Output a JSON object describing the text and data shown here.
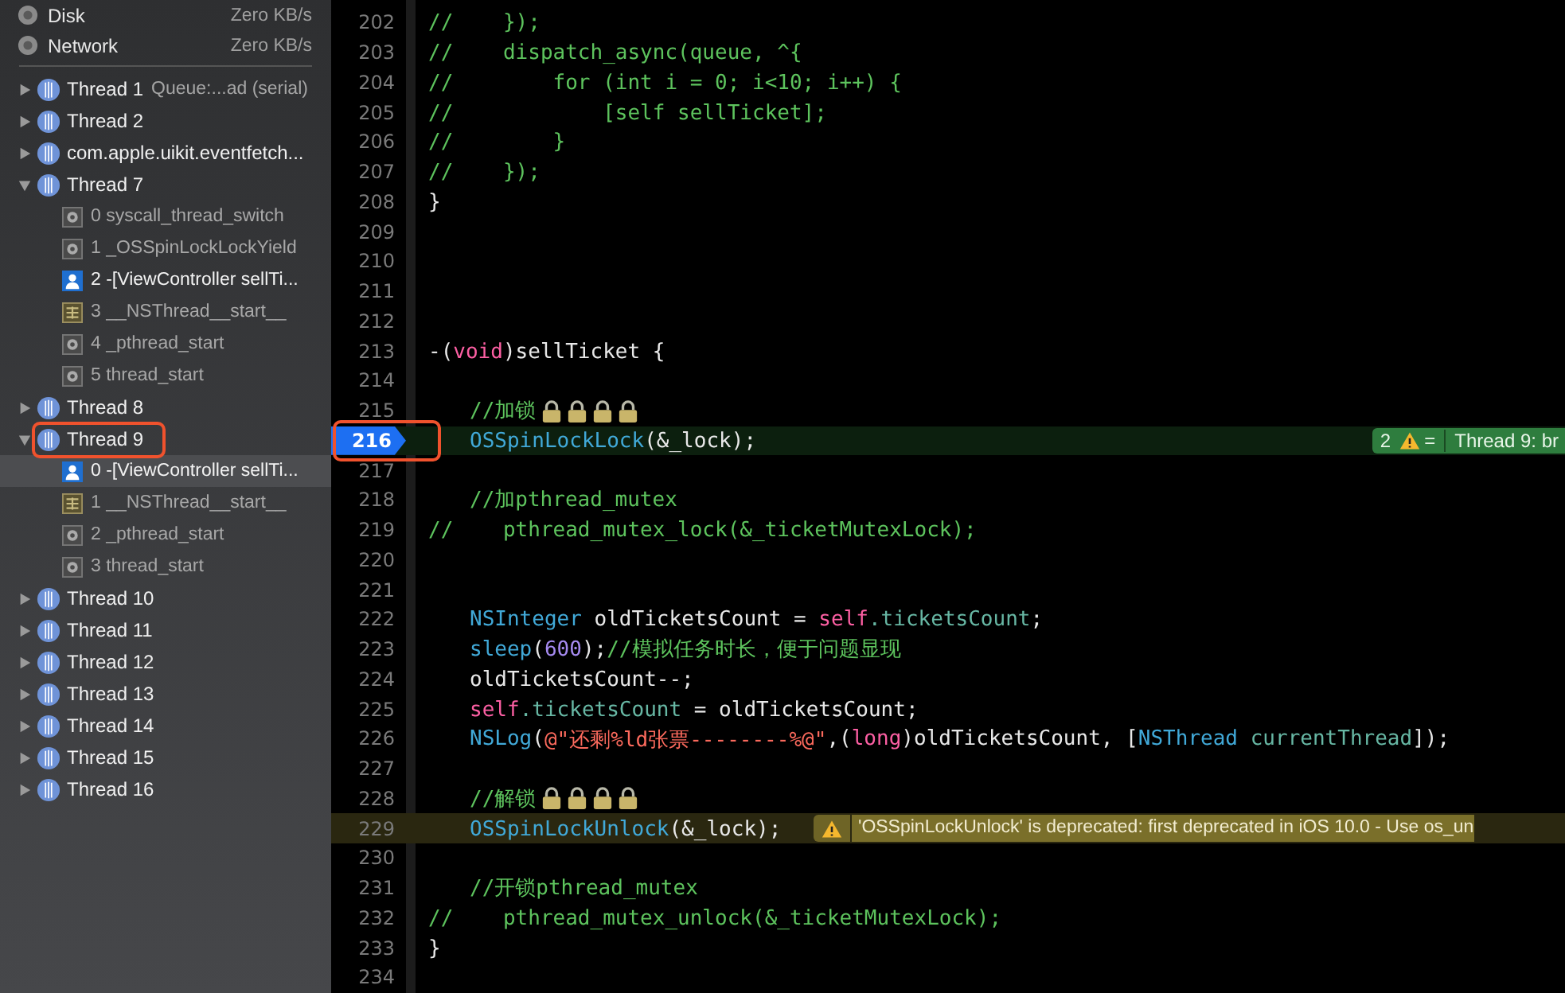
{
  "sidebar": {
    "gauges": [
      {
        "label": "Disk",
        "reading": "Zero KB/s"
      },
      {
        "label": "Network",
        "reading": "Zero KB/s"
      }
    ],
    "threads": [
      {
        "name": "Thread 1",
        "detail": "Queue:...ad (serial)",
        "expanded": false,
        "annotated": false
      },
      {
        "name": "Thread 2",
        "expanded": false,
        "annotated": false
      },
      {
        "name": "com.apple.uikit.eventfetch...",
        "expanded": false,
        "annotated": false
      },
      {
        "name": "Thread 7",
        "expanded": true,
        "annotated": false,
        "children": [
          {
            "label": "0 syscall_thread_switch",
            "kind": "system",
            "selected": false
          },
          {
            "label": "1 _OSSpinLockLockYield",
            "kind": "system",
            "selected": false
          },
          {
            "label": "2 -[ViewController sellTi...",
            "kind": "user",
            "selected": false
          },
          {
            "label": "3 __NSThread__start__",
            "kind": "framework",
            "selected": false
          },
          {
            "label": "4 _pthread_start",
            "kind": "system",
            "selected": false
          },
          {
            "label": "5 thread_start",
            "kind": "system",
            "selected": false
          }
        ]
      },
      {
        "name": "Thread 8",
        "expanded": false,
        "annotated": false
      },
      {
        "name": "Thread 9",
        "expanded": true,
        "annotated": true,
        "children": [
          {
            "label": "0 -[ViewController sellTi...",
            "kind": "user",
            "selected": true
          },
          {
            "label": "1 __NSThread__start__",
            "kind": "framework",
            "selected": false
          },
          {
            "label": "2 _pthread_start",
            "kind": "system",
            "selected": false
          },
          {
            "label": "3 thread_start",
            "kind": "system",
            "selected": false
          }
        ]
      },
      {
        "name": "Thread 10",
        "expanded": false,
        "annotated": false
      },
      {
        "name": "Thread 11",
        "expanded": false,
        "annotated": false
      },
      {
        "name": "Thread 12",
        "expanded": false,
        "annotated": false
      },
      {
        "name": "Thread 13",
        "expanded": false,
        "annotated": false
      },
      {
        "name": "Thread 14",
        "expanded": false,
        "annotated": false
      },
      {
        "name": "Thread 15",
        "expanded": false,
        "annotated": false
      },
      {
        "name": "Thread 16",
        "expanded": false,
        "annotated": false
      }
    ]
  },
  "editor": {
    "lines": [
      {
        "number": "202",
        "kind": "plain",
        "annotated": false,
        "indent": false,
        "tokens": [
          {
            "kind": "comment",
            "t": "//    });"
          }
        ]
      },
      {
        "number": "203",
        "kind": "plain",
        "annotated": false,
        "indent": false,
        "tokens": [
          {
            "kind": "comment",
            "t": "//    dispatch_async(queue, ^{"
          }
        ]
      },
      {
        "number": "204",
        "kind": "plain",
        "annotated": false,
        "indent": false,
        "tokens": [
          {
            "kind": "comment",
            "t": "//        for (int i = 0; i<10; i++) {"
          }
        ]
      },
      {
        "number": "205",
        "kind": "plain",
        "annotated": false,
        "indent": false,
        "tokens": [
          {
            "kind": "comment",
            "t": "//            [self sellTicket];"
          }
        ]
      },
      {
        "number": "206",
        "kind": "plain",
        "annotated": false,
        "indent": false,
        "tokens": [
          {
            "kind": "comment",
            "t": "//        }"
          }
        ]
      },
      {
        "number": "207",
        "kind": "plain",
        "annotated": false,
        "indent": false,
        "tokens": [
          {
            "kind": "comment",
            "t": "//    });"
          }
        ]
      },
      {
        "number": "208",
        "kind": "plain",
        "annotated": false,
        "indent": false,
        "tokens": [
          {
            "kind": "plain",
            "t": "}"
          }
        ]
      },
      {
        "number": "209",
        "kind": "plain",
        "annotated": false
      },
      {
        "number": "210",
        "kind": "plain",
        "annotated": false
      },
      {
        "number": "211",
        "kind": "plain",
        "annotated": false
      },
      {
        "number": "212",
        "kind": "plain",
        "annotated": false
      },
      {
        "number": "213",
        "kind": "plain",
        "annotated": false,
        "indent": false,
        "tokens": [
          {
            "kind": "plain",
            "t": "-("
          },
          {
            "kind": "keyword",
            "t": "void"
          },
          {
            "kind": "plain",
            "t": ")sellTicket {"
          }
        ]
      },
      {
        "number": "214",
        "kind": "plain",
        "annotated": false
      },
      {
        "number": "215",
        "kind": "plain",
        "annotated": false,
        "indent": true,
        "tokens": [
          {
            "kind": "comment",
            "t": "//加锁"
          },
          {
            "kind": "lock"
          },
          {
            "kind": "lock"
          },
          {
            "kind": "lock"
          },
          {
            "kind": "lock"
          }
        ]
      },
      {
        "number": "216",
        "kind": "breakpoint",
        "annotated": true,
        "indent": true,
        "tokens": [
          {
            "kind": "func",
            "t": "OSSpinLockLock"
          },
          {
            "kind": "plain",
            "t": "(&_lock);"
          }
        ],
        "badge": {
          "count": "2",
          "sign": "=",
          "message": "Thread 9: br"
        }
      },
      {
        "number": "217",
        "kind": "plain",
        "annotated": false
      },
      {
        "number": "218",
        "kind": "plain",
        "annotated": false,
        "indent": true,
        "tokens": [
          {
            "kind": "comment",
            "t": "//加pthread_mutex"
          }
        ]
      },
      {
        "number": "219",
        "kind": "plain",
        "annotated": false,
        "indent": false,
        "tokens": [
          {
            "kind": "comment",
            "t": "//    pthread_mutex_lock(&_ticketMutexLock);"
          }
        ]
      },
      {
        "number": "220",
        "kind": "plain",
        "annotated": false
      },
      {
        "number": "221",
        "kind": "plain",
        "annotated": false
      },
      {
        "number": "222",
        "kind": "plain",
        "annotated": false,
        "indent": true,
        "tokens": [
          {
            "kind": "func",
            "t": "NSInteger"
          },
          {
            "kind": "plain",
            "t": " oldTicketsCount = "
          },
          {
            "kind": "keyword",
            "t": "self"
          },
          {
            "kind": "property",
            "t": ".ticketsCount"
          },
          {
            "kind": "plain",
            "t": ";"
          }
        ]
      },
      {
        "number": "223",
        "kind": "plain",
        "annotated": false,
        "indent": true,
        "tokens": [
          {
            "kind": "func",
            "t": "sleep"
          },
          {
            "kind": "plain",
            "t": "("
          },
          {
            "kind": "number",
            "t": "600"
          },
          {
            "kind": "plain",
            "t": ");"
          },
          {
            "kind": "comment",
            "t": "//模拟任务时长，便于问题显现"
          }
        ]
      },
      {
        "number": "224",
        "kind": "plain",
        "annotated": false,
        "indent": true,
        "tokens": [
          {
            "kind": "plain",
            "t": "oldTicketsCount--;"
          }
        ]
      },
      {
        "number": "225",
        "kind": "plain",
        "annotated": false,
        "indent": true,
        "tokens": [
          {
            "kind": "keyword",
            "t": "self"
          },
          {
            "kind": "property",
            "t": ".ticketsCount"
          },
          {
            "kind": "plain",
            "t": " = oldTicketsCount;"
          }
        ]
      },
      {
        "number": "226",
        "kind": "plain",
        "annotated": false,
        "indent": true,
        "tokens": [
          {
            "kind": "func",
            "t": "NSLog"
          },
          {
            "kind": "plain",
            "t": "("
          },
          {
            "kind": "string",
            "t": "@\"还剩%ld张票--------%@\""
          },
          {
            "kind": "plain",
            "t": ",("
          },
          {
            "kind": "keyword",
            "t": "long"
          },
          {
            "kind": "plain",
            "t": ")oldTicketsCount, ["
          },
          {
            "kind": "func",
            "t": "NSThread"
          },
          {
            "kind": "property",
            "t": " currentThread"
          },
          {
            "kind": "plain",
            "t": "]);"
          }
        ]
      },
      {
        "number": "227",
        "kind": "plain",
        "annotated": false
      },
      {
        "number": "228",
        "kind": "plain",
        "annotated": false,
        "indent": true,
        "tokens": [
          {
            "kind": "comment",
            "t": "//解锁"
          },
          {
            "kind": "lock"
          },
          {
            "kind": "lock"
          },
          {
            "kind": "lock"
          },
          {
            "kind": "lock"
          }
        ]
      },
      {
        "number": "229",
        "kind": "warning",
        "annotated": false,
        "indent": true,
        "tokens": [
          {
            "kind": "func",
            "t": "OSSpinLockUnlock"
          },
          {
            "kind": "plain",
            "t": "(&_lock);"
          }
        ],
        "warning": "'OSSpinLockUnlock' is deprecated: first deprecated in iOS 10.0 - Use os_un"
      },
      {
        "number": "230",
        "kind": "plain",
        "annotated": false
      },
      {
        "number": "231",
        "kind": "plain",
        "annotated": false,
        "indent": true,
        "tokens": [
          {
            "kind": "comment",
            "t": "//开锁pthread_mutex"
          }
        ]
      },
      {
        "number": "232",
        "kind": "plain",
        "annotated": false,
        "indent": false,
        "tokens": [
          {
            "kind": "comment",
            "t": "//    pthread_mutex_unlock(&_ticketMutexLock);"
          }
        ]
      },
      {
        "number": "233",
        "kind": "plain",
        "annotated": false,
        "indent": false,
        "tokens": [
          {
            "kind": "plain",
            "t": "}"
          }
        ]
      },
      {
        "number": "234",
        "kind": "plain",
        "annotated": false
      }
    ]
  }
}
